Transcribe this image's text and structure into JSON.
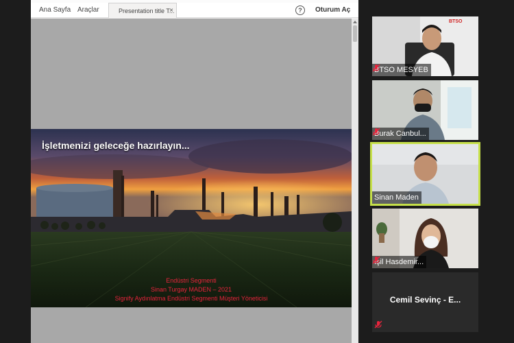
{
  "tabs": {
    "home": "Ana Sayfa",
    "tools": "Araçlar",
    "document": "Presentation title T...",
    "close": "×"
  },
  "toolbar": {
    "help": "?",
    "signin": "Oturum Aç"
  },
  "slide": {
    "headline": "İşletmenizi geleceğe hazırlayın...",
    "line1": "Endüstri Segmenti",
    "line2": "Sinan Turgay MADEN – 2021",
    "line3": "Signify Aydınlatma Endüstri Segmenti Müşteri Yöneticisi"
  },
  "participants": [
    {
      "name": "BTSO MESYEB",
      "muted": true,
      "active": false,
      "logo": "BTSO"
    },
    {
      "name": "Burak Canbul...",
      "muted": true,
      "active": false
    },
    {
      "name": "Sinan Maden",
      "muted": false,
      "active": true
    },
    {
      "name": "Işil Hasdemir...",
      "muted": true,
      "active": false
    },
    {
      "name": "Cemil Sevinç - E...",
      "muted": true,
      "active": false,
      "video_off": true
    }
  ],
  "colors": {
    "active_speaker": "#c6e04a",
    "mic_muted": "#e8243c",
    "slide_text": "#e8243c"
  }
}
